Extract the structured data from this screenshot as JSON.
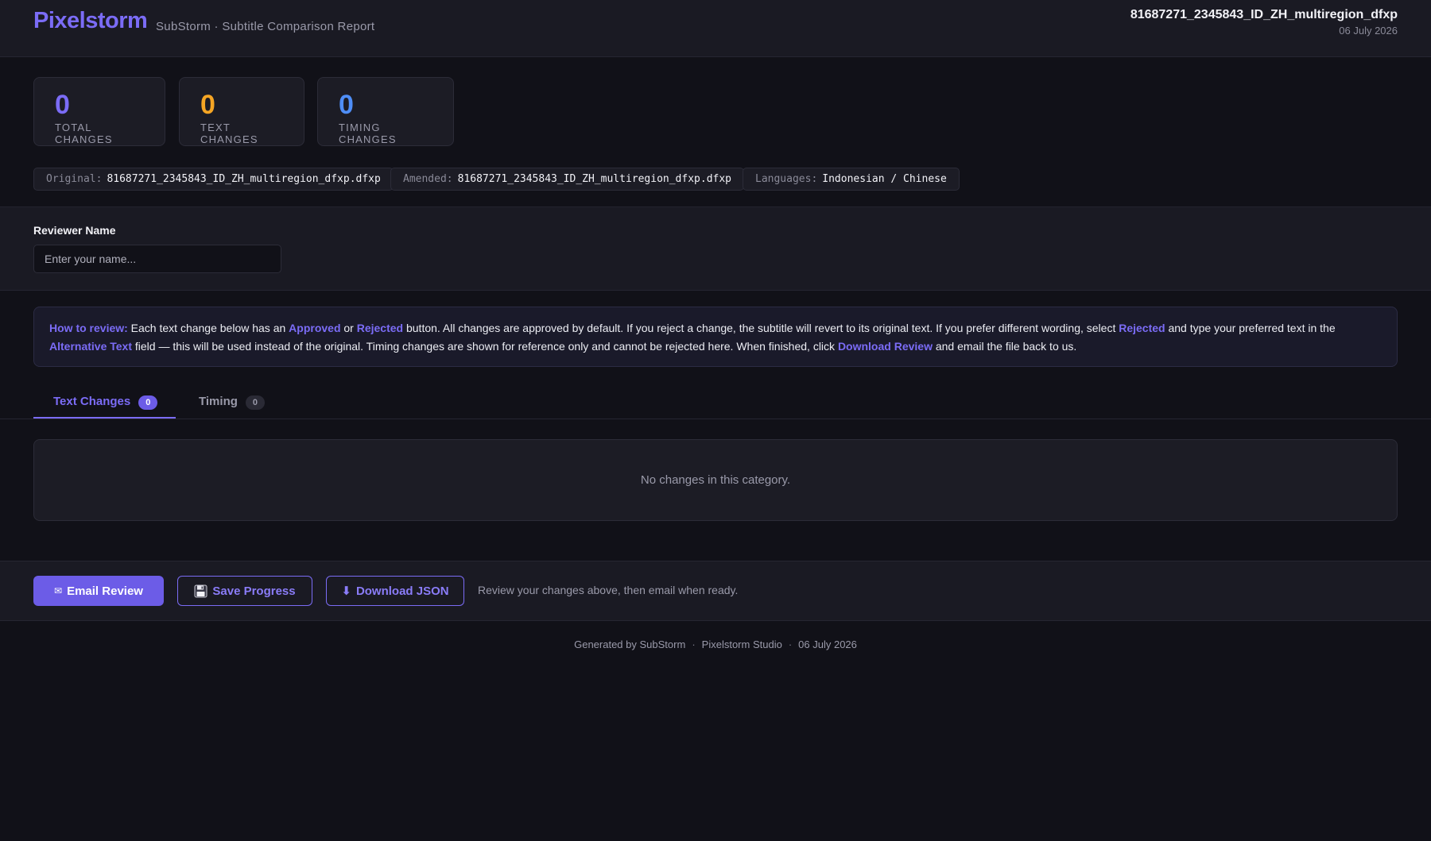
{
  "header": {
    "brand": "Pixelstorm",
    "subtitle": "SubStorm · Subtitle Comparison Report",
    "file_title": "81687271_2345843_ID_ZH_multiregion_dfxp",
    "date": "06 July 2026"
  },
  "stats": [
    {
      "value": "0",
      "label": "TOTAL CHANGES",
      "color": "#7b6cf6"
    },
    {
      "value": "0",
      "label": "TEXT CHANGES",
      "color": "#f5a524"
    },
    {
      "value": "0",
      "label": "TIMING CHANGES",
      "color": "#4f8ef7"
    }
  ],
  "meta": {
    "original_label": "Original:",
    "original_value": "81687271_2345843_ID_ZH_multiregion_dfxp.dfxp",
    "amended_label": "Amended:",
    "amended_value": "81687271_2345843_ID_ZH_multiregion_dfxp.dfxp",
    "languages_label": "Languages:",
    "languages_value": "Indonesian / Chinese"
  },
  "reviewer": {
    "label": "Reviewer Name",
    "placeholder": "Enter your name...",
    "value": ""
  },
  "info": {
    "heading": "How to review:",
    "t1": " Each text change below has an ",
    "approved": "Approved",
    "t2": " or ",
    "rejected": "Rejected",
    "t3": " button. All changes are approved by default. If you reject a change, the subtitle will revert to its original text. If you prefer different wording, select ",
    "rejected2": "Rejected",
    "t4": " and type your preferred text in the ",
    "alt_text": "Alternative Text",
    "t5": " field — this will be used instead of the original. Timing changes are shown for reference only and cannot be rejected here. When finished, click ",
    "download_review": "Download Review",
    "t6": " and email the file back to us."
  },
  "tabs": [
    {
      "label": "Text Changes",
      "count": "0",
      "active": true
    },
    {
      "label": "Timing",
      "count": "0",
      "active": false
    }
  ],
  "empty_message": "No changes in this category.",
  "actions": {
    "email_icon": "✉",
    "email_label": "Email Review",
    "save_icon": "floppy-disk-icon",
    "save_label": "Save Progress",
    "download_icon": "⬇",
    "download_label": "Download JSON",
    "note": "Review your changes above, then email when ready."
  },
  "footer": {
    "generated": "Generated by SubStorm",
    "sep": "·",
    "studio": "Pixelstorm Studio",
    "date": "06 July 2026"
  },
  "colors": {
    "accent": "#7b6cf6",
    "primary_button": "#6c5ce7",
    "text_changes": "#f5a524",
    "timing_changes": "#4f8ef7",
    "background": "#111118",
    "panel": "#1a1a23"
  }
}
